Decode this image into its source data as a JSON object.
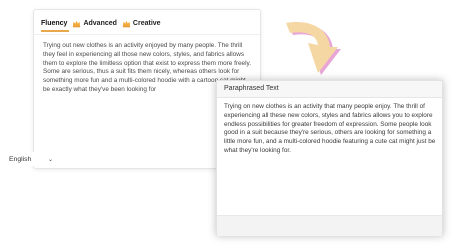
{
  "modes": [
    {
      "label": "Fluency",
      "icon": "",
      "active": true
    },
    {
      "label": "Advanced",
      "icon": "crown-icon",
      "active": false
    },
    {
      "label": "Creative",
      "icon": "crown-icon",
      "active": false
    }
  ],
  "input": {
    "text": "Trying out new clothes is an activity enjoyed by many people. The thrill they feel in experiencing all those new colors, styles, and fabrics allows them to explore the limitless option that exist to express them more freely. Some are serious, thus a suit fits them nicely, whereas others look for something more fun and a multi-colored hoodie with a cartoon cat might be exactly what they've been looking for"
  },
  "language": {
    "selected": "English"
  },
  "output": {
    "title": "Paraphrased Text",
    "text": "Trying on new clothes is an activity that many people enjoy. The thrill of experiencing all these new colors, styles and fabrics allows you to explore endless possibilities for greater freedom of expression. Some people look good in a suit because they're serious, others are looking for something a little more fun, and a multi-colored hoodie featuring a cute cat might just be  what they're looking for."
  },
  "colors": {
    "accent": "#e8a84c",
    "crown": "#f2a93b",
    "arrow_fill": "#f5d7a4",
    "arrow_outline": "#e8a6d6"
  }
}
